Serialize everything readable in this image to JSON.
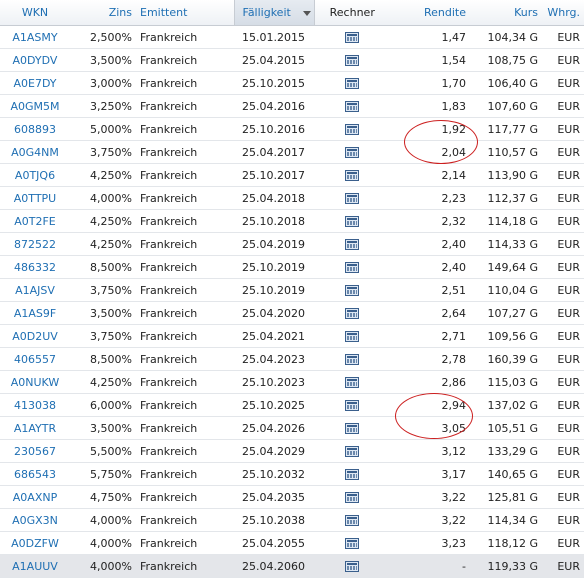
{
  "headers": {
    "wkn": "WKN",
    "zins": "Zins",
    "emittent": "Emittent",
    "faelligkeit": "Fälligkeit",
    "rechner": "Rechner",
    "rendite": "Rendite",
    "kurs": "Kurs",
    "whrg": "Whrg."
  },
  "rows": [
    {
      "wkn": "A1ASMY",
      "zins": "2,500%",
      "emittent": "Frankreich",
      "faelligkeit": "15.01.2015",
      "rendite": "1,47",
      "kurs": "104,34 G",
      "whrg": "EUR"
    },
    {
      "wkn": "A0DYDV",
      "zins": "3,500%",
      "emittent": "Frankreich",
      "faelligkeit": "25.04.2015",
      "rendite": "1,54",
      "kurs": "108,75 G",
      "whrg": "EUR"
    },
    {
      "wkn": "A0E7DY",
      "zins": "3,000%",
      "emittent": "Frankreich",
      "faelligkeit": "25.10.2015",
      "rendite": "1,70",
      "kurs": "106,40 G",
      "whrg": "EUR"
    },
    {
      "wkn": "A0GM5M",
      "zins": "3,250%",
      "emittent": "Frankreich",
      "faelligkeit": "25.04.2016",
      "rendite": "1,83",
      "kurs": "107,60 G",
      "whrg": "EUR"
    },
    {
      "wkn": "608893",
      "zins": "5,000%",
      "emittent": "Frankreich",
      "faelligkeit": "25.10.2016",
      "rendite": "1,92",
      "kurs": "117,77 G",
      "whrg": "EUR"
    },
    {
      "wkn": "A0G4NM",
      "zins": "3,750%",
      "emittent": "Frankreich",
      "faelligkeit": "25.04.2017",
      "rendite": "2,04",
      "kurs": "110,57 G",
      "whrg": "EUR"
    },
    {
      "wkn": "A0TJQ6",
      "zins": "4,250%",
      "emittent": "Frankreich",
      "faelligkeit": "25.10.2017",
      "rendite": "2,14",
      "kurs": "113,90 G",
      "whrg": "EUR"
    },
    {
      "wkn": "A0TTPU",
      "zins": "4,000%",
      "emittent": "Frankreich",
      "faelligkeit": "25.04.2018",
      "rendite": "2,23",
      "kurs": "112,37 G",
      "whrg": "EUR"
    },
    {
      "wkn": "A0T2FE",
      "zins": "4,250%",
      "emittent": "Frankreich",
      "faelligkeit": "25.10.2018",
      "rendite": "2,32",
      "kurs": "114,18 G",
      "whrg": "EUR"
    },
    {
      "wkn": "872522",
      "zins": "4,250%",
      "emittent": "Frankreich",
      "faelligkeit": "25.04.2019",
      "rendite": "2,40",
      "kurs": "114,33 G",
      "whrg": "EUR"
    },
    {
      "wkn": "486332",
      "zins": "8,500%",
      "emittent": "Frankreich",
      "faelligkeit": "25.10.2019",
      "rendite": "2,40",
      "kurs": "149,64 G",
      "whrg": "EUR"
    },
    {
      "wkn": "A1AJSV",
      "zins": "3,750%",
      "emittent": "Frankreich",
      "faelligkeit": "25.10.2019",
      "rendite": "2,51",
      "kurs": "110,04 G",
      "whrg": "EUR"
    },
    {
      "wkn": "A1AS9F",
      "zins": "3,500%",
      "emittent": "Frankreich",
      "faelligkeit": "25.04.2020",
      "rendite": "2,64",
      "kurs": "107,27 G",
      "whrg": "EUR"
    },
    {
      "wkn": "A0D2UV",
      "zins": "3,750%",
      "emittent": "Frankreich",
      "faelligkeit": "25.04.2021",
      "rendite": "2,71",
      "kurs": "109,56 G",
      "whrg": "EUR"
    },
    {
      "wkn": "406557",
      "zins": "8,500%",
      "emittent": "Frankreich",
      "faelligkeit": "25.04.2023",
      "rendite": "2,78",
      "kurs": "160,39 G",
      "whrg": "EUR"
    },
    {
      "wkn": "A0NUKW",
      "zins": "4,250%",
      "emittent": "Frankreich",
      "faelligkeit": "25.10.2023",
      "rendite": "2,86",
      "kurs": "115,03 G",
      "whrg": "EUR"
    },
    {
      "wkn": "413038",
      "zins": "6,000%",
      "emittent": "Frankreich",
      "faelligkeit": "25.10.2025",
      "rendite": "2,94",
      "kurs": "137,02 G",
      "whrg": "EUR"
    },
    {
      "wkn": "A1AYTR",
      "zins": "3,500%",
      "emittent": "Frankreich",
      "faelligkeit": "25.04.2026",
      "rendite": "3,05",
      "kurs": "105,51 G",
      "whrg": "EUR"
    },
    {
      "wkn": "230567",
      "zins": "5,500%",
      "emittent": "Frankreich",
      "faelligkeit": "25.04.2029",
      "rendite": "3,12",
      "kurs": "133,29 G",
      "whrg": "EUR"
    },
    {
      "wkn": "686543",
      "zins": "5,750%",
      "emittent": "Frankreich",
      "faelligkeit": "25.10.2032",
      "rendite": "3,17",
      "kurs": "140,65 G",
      "whrg": "EUR"
    },
    {
      "wkn": "A0AXNP",
      "zins": "4,750%",
      "emittent": "Frankreich",
      "faelligkeit": "25.04.2035",
      "rendite": "3,22",
      "kurs": "125,81 G",
      "whrg": "EUR"
    },
    {
      "wkn": "A0GX3N",
      "zins": "4,000%",
      "emittent": "Frankreich",
      "faelligkeit": "25.10.2038",
      "rendite": "3,22",
      "kurs": "114,34 G",
      "whrg": "EUR"
    },
    {
      "wkn": "A0DZFW",
      "zins": "4,000%",
      "emittent": "Frankreich",
      "faelligkeit": "25.04.2055",
      "rendite": "3,23",
      "kurs": "118,12 G",
      "whrg": "EUR"
    },
    {
      "wkn": "A1AUUV",
      "zins": "4,000%",
      "emittent": "Frankreich",
      "faelligkeit": "25.04.2060",
      "rendite": "-",
      "kurs": "119,33 G",
      "whrg": "EUR"
    }
  ],
  "icons": {
    "rechner": "calculator-icon",
    "sort": "sort-descending-icon"
  },
  "colors": {
    "link": "#1f6fb3",
    "annotation": "#cc1f1f",
    "last_row_bg": "#e4e6ea"
  }
}
